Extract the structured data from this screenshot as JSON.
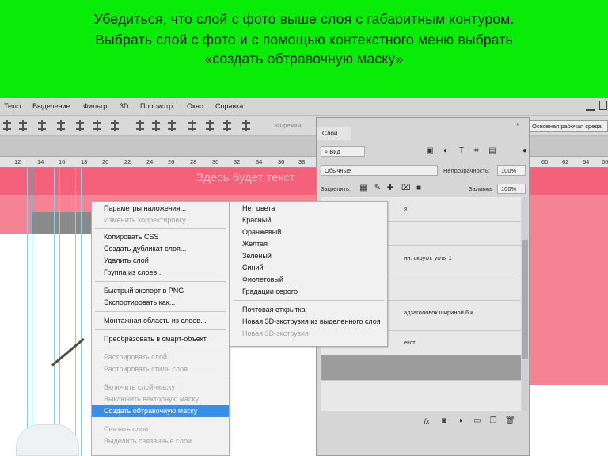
{
  "banner": {
    "line1": "Убедиться, что слой с фото выше слоя с габаритным контуром.",
    "line2": "Выбрать слой с фото и с помощью контекстного меню выбрать",
    "line3": "«создать обтравочную маску»",
    "color": "#08ec08"
  },
  "menubar": {
    "items": [
      "Текст",
      "Выделение",
      "Фильтр",
      "3D",
      "Просмотр",
      "Окно",
      "Справка"
    ]
  },
  "optionsbar": {
    "mode_label": "3D-режим",
    "workspace": "Основная рабочая среда"
  },
  "ruler": {
    "left_numbers": [
      "12",
      "14",
      "16",
      "18",
      "20",
      "22",
      "24",
      "26",
      "28",
      "30",
      "32",
      "34",
      "36",
      "38"
    ],
    "right_numbers": [
      "60",
      "62",
      "64",
      "66"
    ]
  },
  "canvas": {
    "watermark_text": "Здесь будет текст",
    "pink": "#f4617a"
  },
  "layers_panel": {
    "tab_label": "Слои",
    "filter_label": "Вид",
    "blend_mode": "Обычные",
    "opacity_label": "Непрозрачность:",
    "opacity_value": "100%",
    "lock_label": "Закрепить:",
    "fill_label": "Заливка:",
    "fill_value": "100%",
    "layers": [
      {
        "name": "я"
      },
      {
        "name": ""
      },
      {
        "name": "ин, скругл. углы 1"
      },
      {
        "name": ""
      },
      {
        "name": "адзаголовок шириной 6 к."
      },
      {
        "name": "екст"
      },
      {
        "name": ""
      }
    ],
    "footer_icons": [
      "fx-icon",
      "mask-icon",
      "adjustment-icon",
      "folder-icon",
      "new-layer-icon",
      "trash-icon"
    ]
  },
  "context_menu": {
    "items": [
      {
        "label": "Параметры наложения...",
        "disabled": false
      },
      {
        "label": "Изменить корректировку...",
        "disabled": true
      },
      {
        "label": "Копировать CSS",
        "disabled": false
      },
      {
        "label": "Создать дубликат слоя...",
        "disabled": false
      },
      {
        "label": "Удалить слой",
        "disabled": false
      },
      {
        "label": "Группа из слоев...",
        "disabled": false
      },
      {
        "label": "Быстрый экспорт в PNG",
        "disabled": false
      },
      {
        "label": "Экспортировать как...",
        "disabled": false
      },
      {
        "label": "Монтажная область из слоев...",
        "disabled": false
      },
      {
        "label": "Преобразовать в смарт-объект",
        "disabled": false
      },
      {
        "label": "Растрировать слой",
        "disabled": true
      },
      {
        "label": "Растрировать стиль слоя",
        "disabled": true
      },
      {
        "label": "Включить слой-маску",
        "disabled": true
      },
      {
        "label": "Выключить векторную маску",
        "disabled": true
      },
      {
        "label": "Создать обтравочную маску",
        "disabled": false,
        "selected": true
      },
      {
        "label": "Связать слои",
        "disabled": true
      },
      {
        "label": "Выделить связанные слои",
        "disabled": true
      }
    ]
  },
  "color_submenu": {
    "items": [
      {
        "label": "Нет цвета",
        "disabled": false
      },
      {
        "label": "Красный",
        "disabled": false
      },
      {
        "label": "Оранжевый",
        "disabled": false
      },
      {
        "label": "Желтая",
        "disabled": false
      },
      {
        "label": "Зеленый",
        "disabled": false
      },
      {
        "label": "Синий",
        "disabled": false
      },
      {
        "label": "Фиолетовый",
        "disabled": false
      },
      {
        "label": "Градации серого",
        "disabled": false
      },
      {
        "label": "Почтовая открытка",
        "disabled": false
      },
      {
        "label": "Новая 3D-экструзия из выделенного слоя",
        "disabled": false
      },
      {
        "label": "Новая 3D-экструзия",
        "disabled": true
      }
    ]
  }
}
